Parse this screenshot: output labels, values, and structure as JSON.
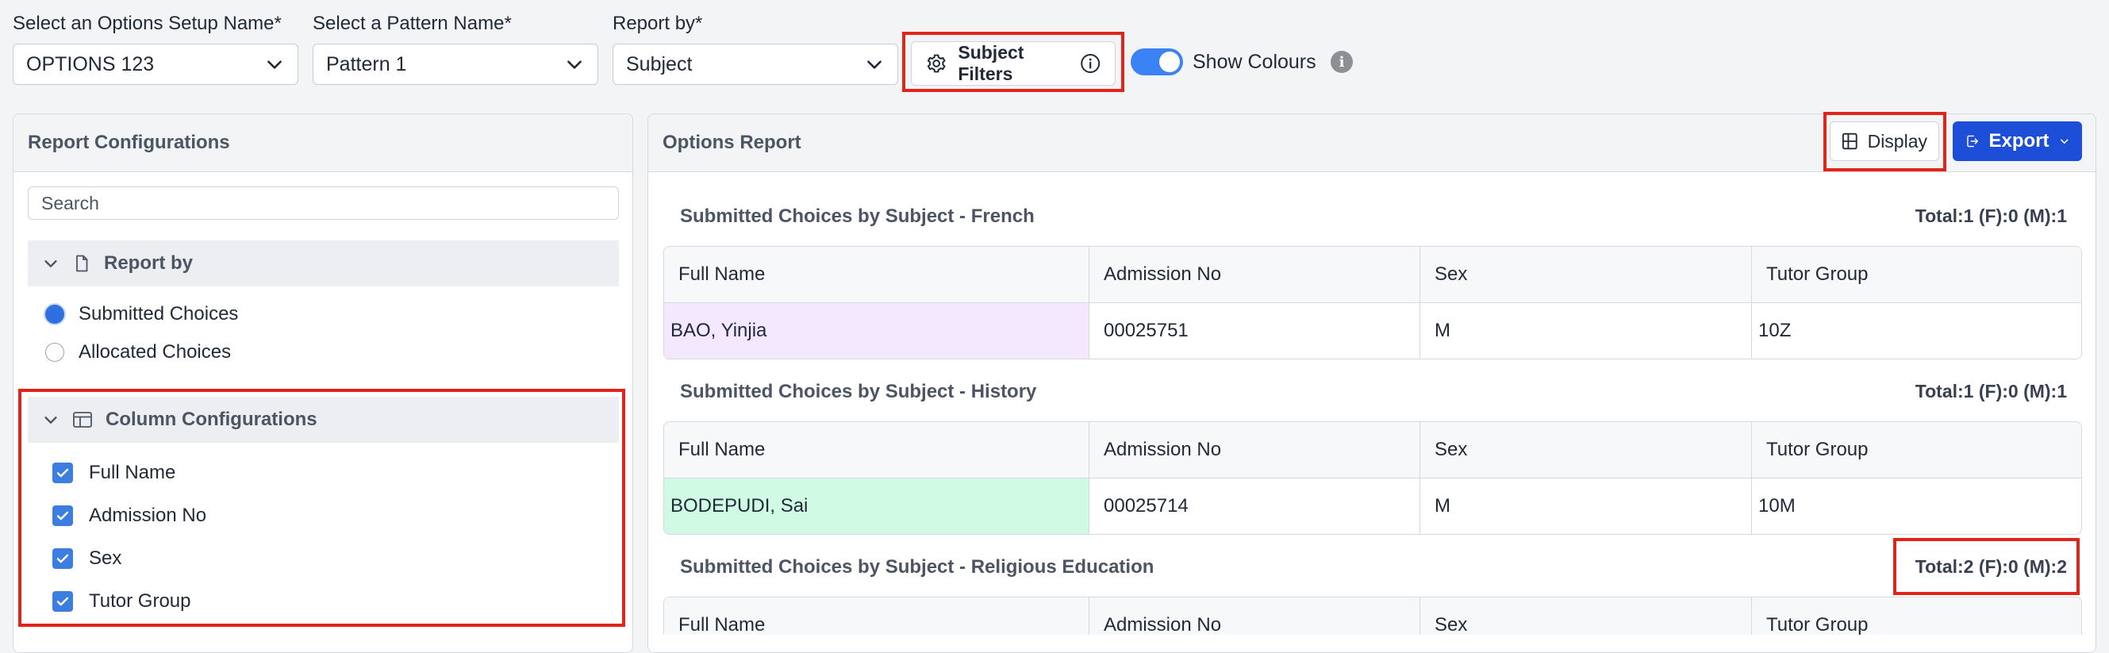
{
  "toolbar": {
    "options_setup": {
      "label": "Select an Options Setup Name*",
      "value": "OPTIONS 123"
    },
    "pattern": {
      "label": "Select a Pattern Name*",
      "value": "Pattern 1"
    },
    "report_by": {
      "label": "Report by*",
      "value": "Subject"
    },
    "subject_filters_label": "Subject Filters",
    "show_colours_label": "Show Colours",
    "show_colours_on": true
  },
  "left_panel": {
    "title": "Report Configurations",
    "search_placeholder": "Search",
    "report_by_section": {
      "title": "Report by",
      "options": [
        {
          "label": "Submitted Choices",
          "selected": true
        },
        {
          "label": "Allocated Choices",
          "selected": false
        }
      ]
    },
    "column_config": {
      "title": "Column Configurations",
      "items": [
        {
          "label": "Full Name",
          "checked": true
        },
        {
          "label": "Admission No",
          "checked": true
        },
        {
          "label": "Sex",
          "checked": true
        },
        {
          "label": "Tutor Group",
          "checked": true
        }
      ]
    }
  },
  "right_panel": {
    "title": "Options Report",
    "display_label": "Display",
    "export_label": "Export",
    "columns": [
      "Full Name",
      "Admission No",
      "Sex",
      "Tutor Group"
    ],
    "sections": [
      {
        "title": "Submitted Choices by Subject - French",
        "total": "Total:1 (F):0 (M):1",
        "rows": [
          {
            "name": "BAO, Yinjia",
            "admission": "00025751",
            "sex": "M",
            "tutor": "10Z",
            "colour": "#f3e8ff"
          }
        ]
      },
      {
        "title": "Submitted Choices by Subject - History",
        "total": "Total:1 (F):0 (M):1",
        "rows": [
          {
            "name": "BODEPUDI, Sai",
            "admission": "00025714",
            "sex": "M",
            "tutor": "10M",
            "colour": "#d1fae5"
          }
        ]
      },
      {
        "title": "Submitted Choices by Subject - Religious Education",
        "total": "Total:2 (F):0 (M):2",
        "rows": []
      }
    ]
  },
  "colors": {
    "accent": "#3b82f6",
    "highlight": "#e2231a",
    "export_bg": "#1d4ed8"
  }
}
